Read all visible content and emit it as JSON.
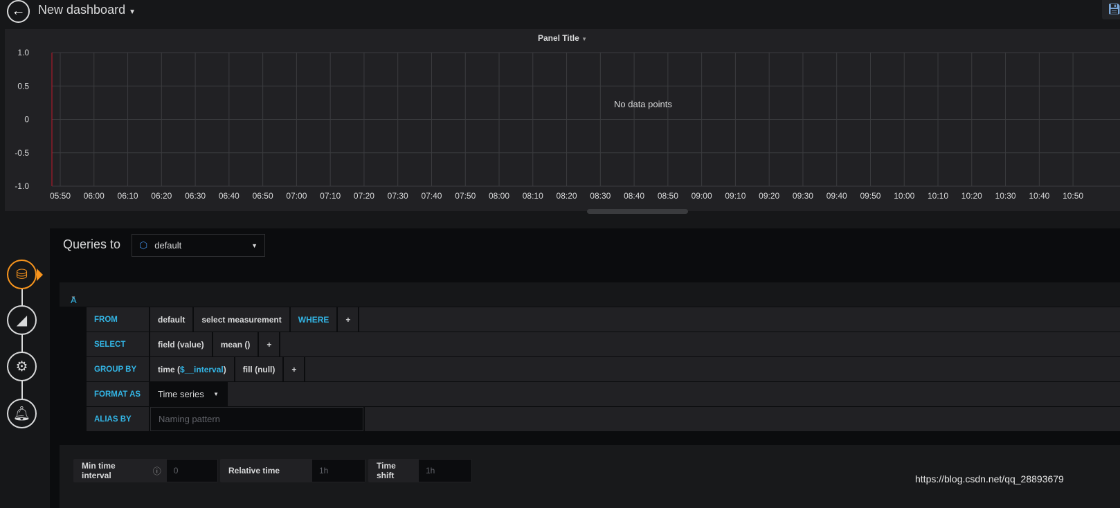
{
  "header": {
    "title": "New dashboard",
    "back_icon": "arrow-left-icon",
    "save_icon": "save-icon"
  },
  "panel": {
    "title": "Panel Title",
    "no_data": "No data points"
  },
  "chart_data": {
    "type": "line",
    "title": "Panel Title",
    "series": [],
    "ylim": [
      -1,
      1
    ],
    "grid": true,
    "y_ticks": [
      "1.0",
      "0.5",
      "0",
      "-0.5",
      "-1.0"
    ],
    "x_ticks": [
      "05:50",
      "06:00",
      "06:10",
      "06:20",
      "06:30",
      "06:40",
      "06:50",
      "07:00",
      "07:10",
      "07:20",
      "07:30",
      "07:40",
      "07:50",
      "08:00",
      "08:10",
      "08:20",
      "08:30",
      "08:40",
      "08:50",
      "09:00",
      "09:10",
      "09:20",
      "09:30",
      "09:40",
      "09:50",
      "10:00",
      "10:10",
      "10:20",
      "10:30",
      "10:40",
      "10:50"
    ],
    "annotation": "No data points",
    "marker_color": "#c4162a"
  },
  "editor": {
    "queries_to": "Queries to",
    "datasource": "default",
    "nav": [
      {
        "icon": "database-icon",
        "active": true
      },
      {
        "icon": "area-chart-icon"
      },
      {
        "icon": "gear-wrench-icon"
      },
      {
        "icon": "bell-icon"
      }
    ],
    "query": {
      "ref": "A",
      "from": {
        "label": "FROM",
        "db": "default",
        "measurement": "select measurement",
        "where": "WHERE"
      },
      "select": {
        "label": "SELECT",
        "field": "field (value)",
        "fn": "mean ()"
      },
      "group_by": {
        "label": "GROUP BY",
        "time_pre": "time (",
        "time_var": "$__interval",
        "time_post": ")",
        "fill": "fill (null)"
      },
      "format_as": {
        "label": "FORMAT AS",
        "value": "Time series"
      },
      "alias_by": {
        "label": "ALIAS BY",
        "placeholder": "Naming pattern"
      },
      "plus": "+"
    },
    "options": {
      "min_interval_label": "Min time interval",
      "min_interval_placeholder": "0",
      "relative_label": "Relative time",
      "relative_placeholder": "1h",
      "shift_label": "Time shift",
      "shift_placeholder": "1h"
    }
  },
  "watermark": "https://blog.csdn.net/qq_28893679",
  "colors": {
    "accent": "#33b5e5",
    "active_nav": "#f7941d"
  }
}
